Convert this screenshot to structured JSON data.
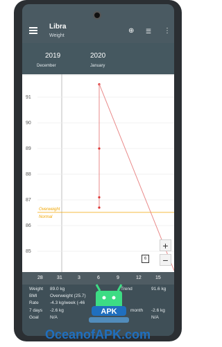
{
  "app": {
    "title": "Libra",
    "subtitle": "Weight"
  },
  "toolbar": {
    "add_icon": "add-circle-icon",
    "list_icon": "list-icon",
    "more_icon": "more-vert-icon",
    "menu_icon": "menu-icon"
  },
  "timeline": {
    "years": [
      {
        "year": "2019",
        "month": "December"
      },
      {
        "year": "2020",
        "month": "January"
      }
    ]
  },
  "chart_data": {
    "type": "line",
    "y_ticks": [
      "91",
      "90",
      "89",
      "88",
      "87",
      "86",
      "85"
    ],
    "x_ticks": [
      "28",
      "31",
      "3",
      "6",
      "9",
      "12",
      "15"
    ],
    "bands": [
      {
        "label": "Overweight",
        "color": "#f0a500"
      },
      {
        "label": "Normal",
        "color": "#f0a500"
      }
    ],
    "points": [
      91.5,
      89.0,
      87.1,
      86.7
    ],
    "trend_color": "#e98a8a"
  },
  "controls": {
    "zoom_in": "+",
    "zoom_out": "−",
    "calendar_day": "6"
  },
  "stats": {
    "weight_label": "Weight",
    "weight_value": "89.0 kg",
    "trend_label": "Trend",
    "trend_value": "91.6 kg",
    "bmi_label": "BMI",
    "bmi_value": "Overweight (25.7)",
    "rate_label": "Rate",
    "rate_value": "-4.3 kg/week (-46",
    "days7_label": "7 days",
    "days7_value": "-2.6 kg",
    "month_label": "month",
    "month_value": "-2.6 kg",
    "goal_label": "Goal",
    "goal_value": "N/A",
    "expected_value": "N/A"
  },
  "watermark": "OceanofAPK.com",
  "logo_text": "APK",
  "colors": {
    "appbar": "#4a5a62",
    "chart_line": "#e98a8a",
    "band": "#f0a500",
    "android_green": "#3ddc84"
  }
}
